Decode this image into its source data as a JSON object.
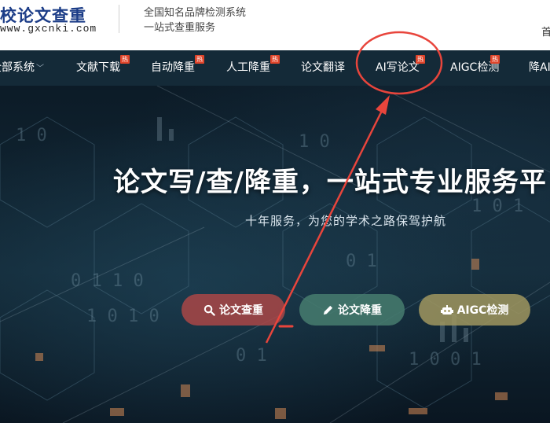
{
  "header": {
    "logo_title": "校论文查重",
    "logo_url": "www.gxcnki.com",
    "tagline_1": "全国知名品牌检测系统",
    "tagline_2": "一站式查重服务",
    "edge_char": "首"
  },
  "nav": {
    "items": [
      {
        "label": "全部系统",
        "has_dropdown": true
      },
      {
        "label": "文献下载",
        "hot": true
      },
      {
        "label": "自动降重",
        "hot": true
      },
      {
        "label": "人工降重",
        "hot": true
      },
      {
        "label": "论文翻译"
      },
      {
        "label": "AI写论文",
        "hot": true,
        "highlighted": true
      },
      {
        "label": "AIGC检测",
        "hot": true
      },
      {
        "label": "降AI"
      }
    ],
    "hot_badge": "热",
    "dropdown_arrow": "﹀"
  },
  "hero": {
    "title": "论文写/查/降重，一站式专业服务平",
    "subtitle": "十年服务，为您的学术之路保驾护航",
    "buttons": [
      {
        "label": "论文查重",
        "icon": "search-icon"
      },
      {
        "label": "论文降重",
        "icon": "pencil-icon"
      },
      {
        "label": "AIGC检测",
        "icon": "robot-icon"
      }
    ]
  },
  "colors": {
    "nav_bg": "#142a38",
    "annotation_red": "#e8453c",
    "hot_badge": "#e0452b",
    "logo_blue": "#1b3c87"
  }
}
